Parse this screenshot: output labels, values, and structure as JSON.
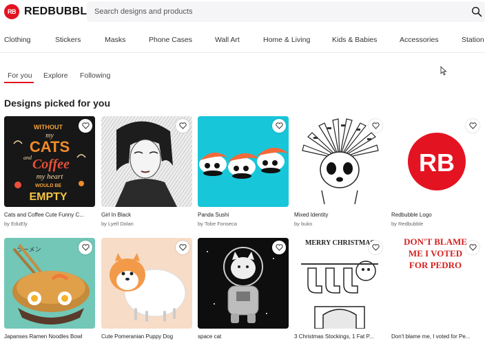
{
  "header": {
    "logo_badge": "RB",
    "logo_text": "REDBUBBLE",
    "search_placeholder": "Search designs and products",
    "brand_color": "#e41321"
  },
  "categories": [
    "Clothing",
    "Stickers",
    "Masks",
    "Phone Cases",
    "Wall Art",
    "Home & Living",
    "Kids & Babies",
    "Accessories",
    "Station"
  ],
  "tabs": [
    "For you",
    "Explore",
    "Following"
  ],
  "active_tab": "For you",
  "section_title": "Designs picked for you",
  "row1": [
    {
      "title": "Cats and Coffee Cute Funny C...",
      "artist": "by EduEly",
      "art": "cats-coffee-lettering",
      "art_text": [
        "WITHOUT",
        "my",
        "CATS",
        "and",
        "Coffee",
        "my heart",
        "WOULD BE",
        "EMPTY"
      ]
    },
    {
      "title": "Girl In Black",
      "artist": "by Lyell Dolan",
      "art": "sketch-portrait"
    },
    {
      "title": "Panda Sushi",
      "artist": "by Tobe Fonseca",
      "art": "panda-sushi"
    },
    {
      "title": "Mixed Identity",
      "artist": "by buko",
      "art": "panda-headdress"
    },
    {
      "title": "Redbubble Logo",
      "artist": "by Redbubble",
      "art": "rb-logo",
      "art_text": [
        "RB"
      ]
    }
  ],
  "row2": [
    {
      "title": "Japanses Ramen Noodles Bowl",
      "artist": "",
      "art": "ramen-bowl",
      "art_text": [
        "ラーメン"
      ]
    },
    {
      "title": "Cute Pomeranian Puppy Dog",
      "artist": "",
      "art": "pomeranian"
    },
    {
      "title": "space cat",
      "artist": "",
      "art": "space-cat"
    },
    {
      "title": "3 Christmas Stockings, 1 Fat P...",
      "artist": "",
      "art": "christmas-stockings",
      "art_text": [
        "MERRY CHRISTMAS"
      ]
    },
    {
      "title": "Don't blame me, I voted for Pe...",
      "artist": "",
      "art": "vote-pedro-text",
      "art_text": [
        "DON'T BLAME",
        "ME I VOTED",
        "FOR PEDRO"
      ]
    }
  ]
}
